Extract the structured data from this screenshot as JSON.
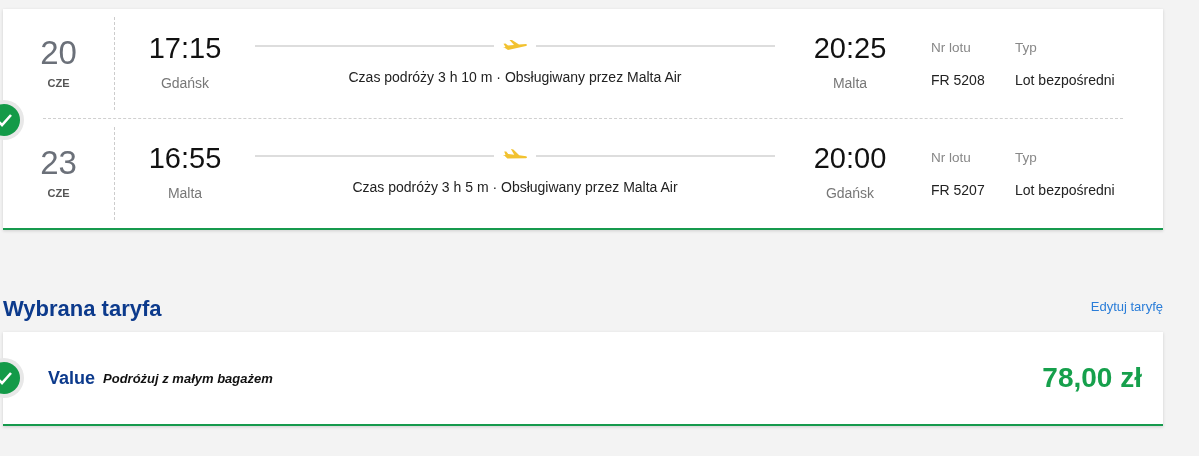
{
  "flights": [
    {
      "day": "20",
      "month": "CZE",
      "departure_time": "17:15",
      "departure_city": "Gdańsk",
      "summary": "Czas podróży 3 h 10 m · Obsługiwany przez Malta Air",
      "arrival_time": "20:25",
      "arrival_city": "Malta",
      "flight_no_label": "Nr lotu",
      "flight_no": "FR 5208",
      "type_label": "Typ",
      "type": "Lot bezpośredni"
    },
    {
      "day": "23",
      "month": "CZE",
      "departure_time": "16:55",
      "departure_city": "Malta",
      "summary": "Czas podróży 3 h 5 m · Obsługiwany przez Malta Air",
      "arrival_time": "20:00",
      "arrival_city": "Gdańsk",
      "flight_no_label": "Nr lotu",
      "flight_no": "FR 5207",
      "type_label": "Typ",
      "type": "Lot bezpośredni"
    }
  ],
  "flights_selected": true,
  "fare": {
    "title": "Wybrana taryfa",
    "edit_link": "Edytuj taryfę",
    "name": "Value",
    "description": "Podróżuj z małym bagażem",
    "price": "78,00 zł",
    "selected": true
  }
}
